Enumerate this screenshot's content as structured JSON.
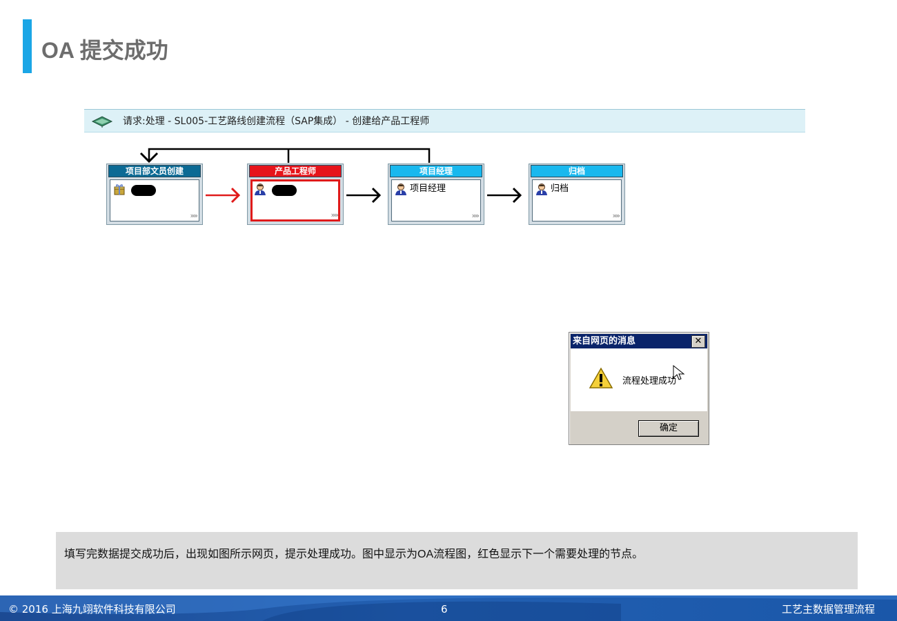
{
  "slide": {
    "title": "OA 提交成功"
  },
  "request_bar": {
    "icon": "network-hub-icon",
    "text": "请求:处理 - SL005-工艺路线创建流程（SAP集成） - 创建给产品工程师"
  },
  "workflow": {
    "nodes": [
      {
        "title": "项目部文员创建",
        "header_color": "#0b6a94",
        "icon": "gift-box-icon",
        "name": "",
        "more": "»»",
        "current": false
      },
      {
        "title": "产品工程师",
        "header_color": "#e6141b",
        "icon": "person-icon",
        "name": "",
        "more": "»»",
        "current": true
      },
      {
        "title": "项目经理",
        "header_color": "#19b8ee",
        "icon": "person-icon",
        "name": "项目经理",
        "more": "»»",
        "current": false
      },
      {
        "title": "归档",
        "header_color": "#19b8ee",
        "icon": "person-icon",
        "name": "归档",
        "more": "»»",
        "current": false
      }
    ],
    "current_color": "#e01a1a"
  },
  "dialog": {
    "title": "来自网页的消息",
    "close_label": "✕",
    "message": "流程处理成功",
    "ok_label": "确定",
    "icon": "warning-icon"
  },
  "caption": {
    "text": "填写完数据提交成功后，出现如图所示网页，提示处理成功。图中显示为OA流程图，红色显示下一个需要处理的节点。"
  },
  "footer": {
    "copyright": "© 2016 上海九翊软件科技有限公司",
    "page_number": "6",
    "doc_title": "工艺主数据管理流程"
  }
}
